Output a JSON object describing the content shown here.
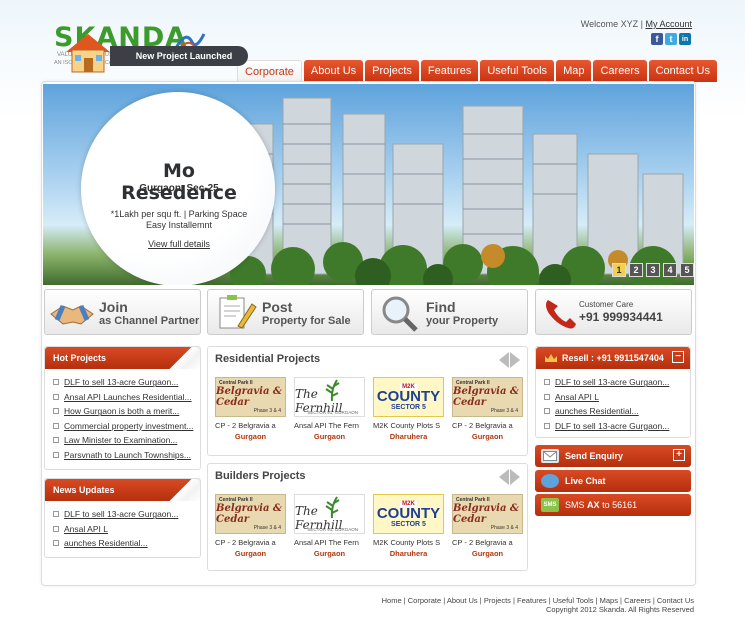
{
  "header": {
    "logo": "SKANDA",
    "logo_tagline": "VALUE YOUR TRUST",
    "logo_cert": "AN ISO 9001 : 2008 Certified Company",
    "welcome": "Welcome XYZ",
    "my_account": "My Account",
    "social": [
      {
        "icon": "facebook-icon",
        "glyph": "f",
        "color": "#3b5998"
      },
      {
        "icon": "twitter-icon",
        "glyph": "t",
        "color": "#3fa9e0"
      },
      {
        "icon": "linkedin-icon",
        "glyph": "in",
        "color": "#0e76a8"
      }
    ]
  },
  "nav": [
    "Corporate",
    "About Us",
    "Projects",
    "Features",
    "Useful Tools",
    "Map",
    "Careers",
    "Contact Us"
  ],
  "banner": {
    "badge": "New Project Launched",
    "title": "Mo Resedence",
    "location": "Gurgaon, Sec-25",
    "desc_line1": "*1Lakh per squ ft. | Parking Space",
    "desc_line2": "Easy Installemnt",
    "link": "View full details",
    "slides": [
      "1",
      "2",
      "3",
      "4",
      "5"
    ],
    "active_slide": "1"
  },
  "cta": [
    {
      "title": "Join",
      "subtitle": "as Channel Partner",
      "icon": "handshake-icon"
    },
    {
      "title": "Post",
      "subtitle": "Property for Sale",
      "icon": "clipboard-pencil-icon"
    },
    {
      "title": "Find",
      "subtitle": "your Property",
      "icon": "magnifier-icon"
    },
    {
      "title": "Customer Care",
      "subtitle": "+91 999934441",
      "icon": "phone-icon"
    }
  ],
  "hot_projects": {
    "title": "Hot Projects",
    "items": [
      "DLF to sell 13-acre Gurgaon...",
      "Ansal API Launches Residential...",
      "How Gurgaon is both a merit...",
      "Commercial property investment...",
      "Law Minister to Examination...",
      "Parsvnath to Launch Townships..."
    ]
  },
  "news_updates": {
    "title": "News Updates",
    "items": [
      "DLF to sell 13-acre Gurgaon...",
      "Ansal API L",
      "aunches Residential..."
    ]
  },
  "residential": {
    "title": "Residential Projects",
    "cards": [
      {
        "type": "cp",
        "caption": "CP - 2 Belgravia a",
        "loc": "Gurgaon"
      },
      {
        "type": "fh",
        "caption": "Ansal API The Fern",
        "loc": "Gurgaon"
      },
      {
        "type": "mc",
        "caption": "M2K County Plots S",
        "loc": "Dharuhera"
      },
      {
        "type": "cp",
        "caption": "CP - 2 Belgravia a",
        "loc": "Gurgaon"
      }
    ]
  },
  "builders": {
    "title": "Builders Projects",
    "cards": [
      {
        "type": "cp",
        "caption": "CP - 2 Belgravia a",
        "loc": "Gurgaon"
      },
      {
        "type": "fh",
        "caption": "Ansal API The Fern",
        "loc": "Gurgaon"
      },
      {
        "type": "mc",
        "caption": "M2K County Plots S",
        "loc": "Dharuhera"
      },
      {
        "type": "cp",
        "caption": "CP - 2 Belgravia a",
        "loc": "Gurgaon"
      }
    ]
  },
  "thumbs": {
    "cp_top": "Central Park II",
    "cp_main": "Belgravia & Cedar",
    "cp_phase": "Phase 3 & 4",
    "fh_main": "The Fernhill",
    "fh_sub": "SECTOR 91, GURGAON",
    "mc_top": "M2K",
    "mc_main": "COUNTY",
    "mc_sub": "SECTOR 5"
  },
  "resale": {
    "title": "Resell : +91 9911547404",
    "items": [
      "DLF to sell 13-acre Gurgaon...",
      "Ansal API L",
      "aunches Residential...",
      "DLF to sell 13-acre Gurgaon..."
    ]
  },
  "right_buttons": {
    "enquiry": "Send Enquiry",
    "chat": "Live Chat",
    "sms_prefix": "SMS",
    "sms_code": "AX",
    "sms_to": "to 56161",
    "sms_icon": "SMS"
  },
  "footer": {
    "links": [
      "Home",
      "Corporate",
      "About Us",
      "Projects",
      "Features",
      "Useful Tools",
      "Maps",
      "Careers",
      "Contact Us"
    ],
    "copyright": "Copyright 2012 Skanda. All Rights Reserved"
  }
}
